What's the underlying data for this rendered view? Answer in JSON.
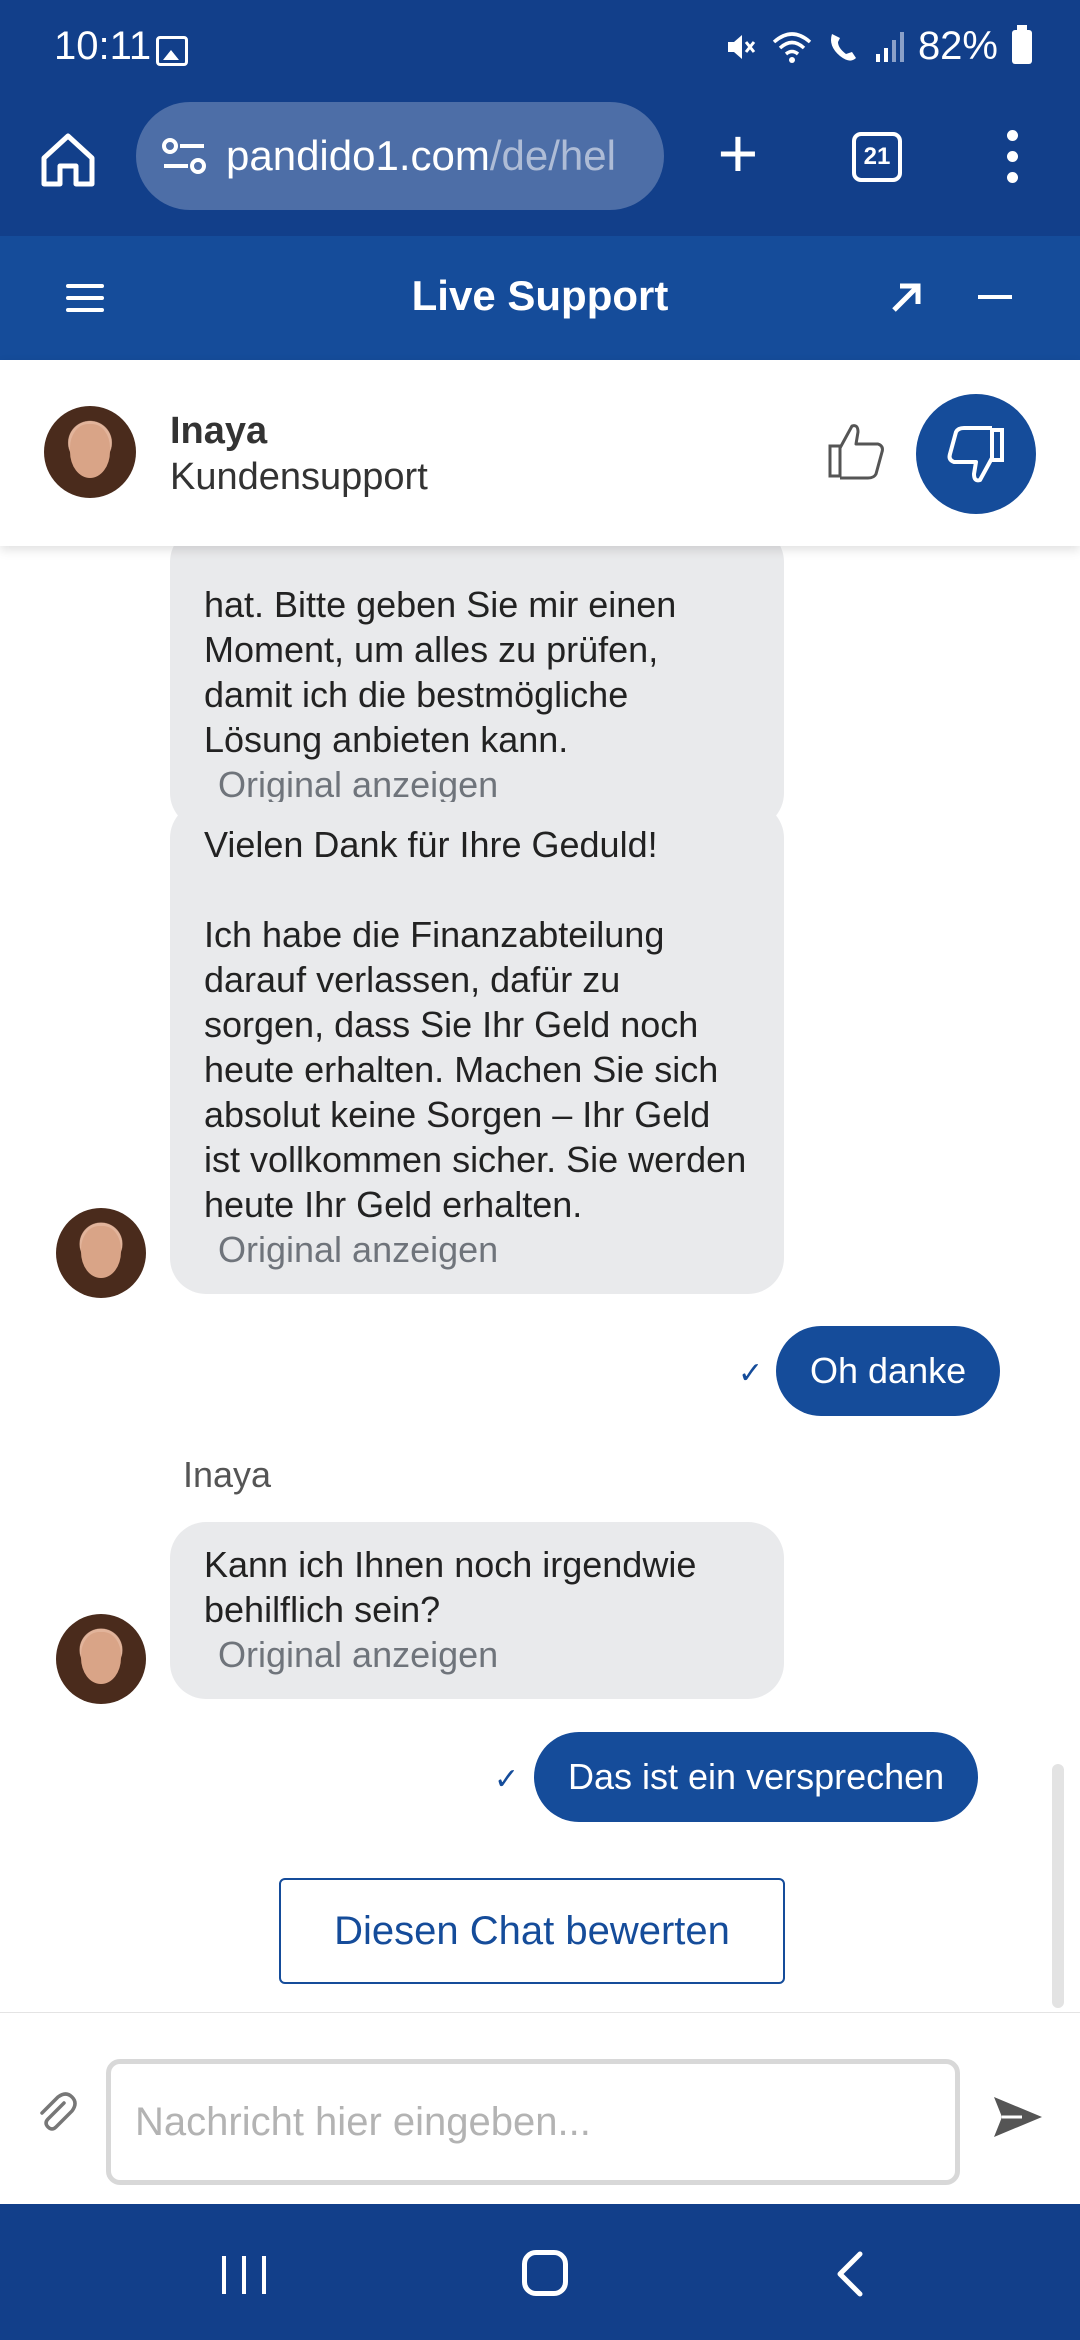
{
  "status_bar": {
    "time": "10:11",
    "battery": "82%"
  },
  "browser": {
    "url_domain": "pandido1.com",
    "url_path": "/de/hel",
    "tab_count": "21"
  },
  "header": {
    "title": "Live Support"
  },
  "agent": {
    "name": "Inaya",
    "role": "Kundensupport"
  },
  "messages": {
    "msg1_text": "hat. Bitte geben Sie mir einen Moment, um alles zu prüfen, damit ich die bestmögliche Lösung anbieten kann.",
    "msg1_original": "Original anzeigen",
    "msg2_line1": "Vielen Dank für Ihre Geduld!",
    "msg2_line2": "Ich habe die Finanzabteilung darauf verlassen, dafür zu sorgen, dass Sie Ihr Geld noch heute erhalten. Machen Sie sich absolut keine Sorgen – Ihr Geld ist vollkommen sicher. Sie werden heute Ihr Geld erhalten.",
    "msg2_original": "Original anzeigen",
    "reply1": "Oh danke",
    "sender_label": "Inaya",
    "msg3_text": "Kann ich Ihnen noch irgendwie behilflich sein?",
    "msg3_original": "Original anzeigen",
    "reply2": "Das ist ein versprechen"
  },
  "rate_button": "Diesen Chat bewerten",
  "input": {
    "placeholder": "Nachricht hier eingeben..."
  },
  "colors": {
    "primary": "#154c9a",
    "system_bar": "#123f8a",
    "bubble_in": "#e9eaec"
  }
}
